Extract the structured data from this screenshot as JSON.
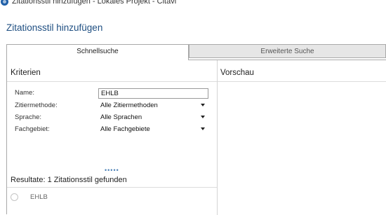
{
  "window": {
    "title": "Zitationsstil hinzufügen - Lokales Projekt - Citavi"
  },
  "dialog": {
    "title": "Zitationsstil hinzufügen"
  },
  "tabs": [
    {
      "label": "Schnellsuche",
      "active": true
    },
    {
      "label": "Erweiterte Suche",
      "active": false
    }
  ],
  "criteria": {
    "heading": "Kriterien",
    "name": {
      "label": "Name:",
      "value": "EHLB"
    },
    "method": {
      "label": "Zitiermethode:",
      "value": "Alle Zitiermethoden"
    },
    "language": {
      "label": "Sprache:",
      "value": "Alle Sprachen"
    },
    "field": {
      "label": "Fachgebiet:",
      "value": "Alle Fachgebiete"
    }
  },
  "preview": {
    "heading": "Vorschau"
  },
  "results": {
    "heading": "Resultate: 1 Zitationsstil gefunden",
    "items": [
      {
        "label": "EHLB",
        "selected": false
      }
    ]
  },
  "colors": {
    "accent": "#1f4f82",
    "tab_inactive_bg": "#e6e6e6",
    "border": "#a9a9a9"
  },
  "icons": {
    "app": "citavi-app-icon",
    "dropdown": "chevron-down-icon"
  }
}
